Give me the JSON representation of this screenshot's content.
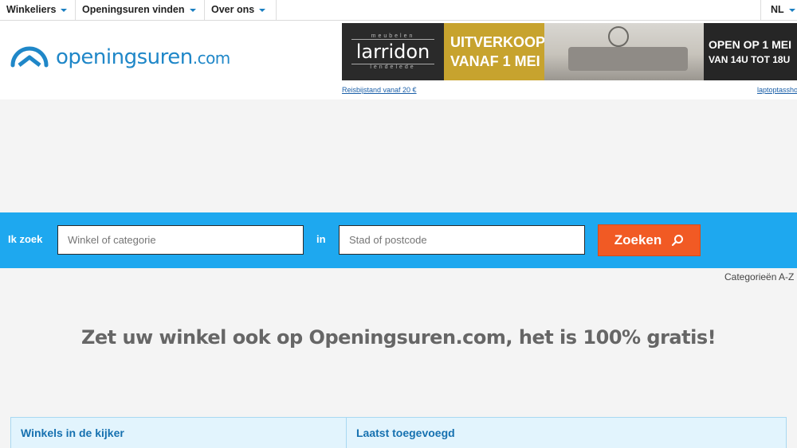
{
  "nav": {
    "items": [
      {
        "label": "Winkeliers"
      },
      {
        "label": "Openingsuren vinden"
      },
      {
        "label": "Over ons"
      }
    ],
    "language": "NL"
  },
  "header": {
    "logo_main": "openingsuren",
    "logo_domain": ".com",
    "ad": {
      "brand_small": "meubelen",
      "brand_name": "larridon",
      "brand_sub": "lendelede",
      "offer_line1": "UITVERKOOP",
      "offer_line2": "VANAF 1 MEI",
      "open_line1": "OPEN OP 1 MEI",
      "open_line2": "VAN 14U TOT 18U"
    },
    "ad_links": [
      "Reisbijstand vanaf 20 €",
      "laptoptassho"
    ]
  },
  "search": {
    "label_what": "Ik zoek",
    "placeholder_what": "Winkel of categorie",
    "label_where": "in",
    "placeholder_where": "Stad of postcode",
    "button_label": "Zoeken"
  },
  "categories_link": "Categorieën A-Z",
  "promo_text": "Zet uw winkel ook op Openingsuren.com, het is 100% gratis!",
  "boxes": [
    {
      "title": "Winkels in de kijker"
    },
    {
      "title": "Laatst toegevoegd"
    }
  ],
  "colors": {
    "accent": "#1ea8ef",
    "button": "#f15a24",
    "logo": "#1f87c8"
  }
}
